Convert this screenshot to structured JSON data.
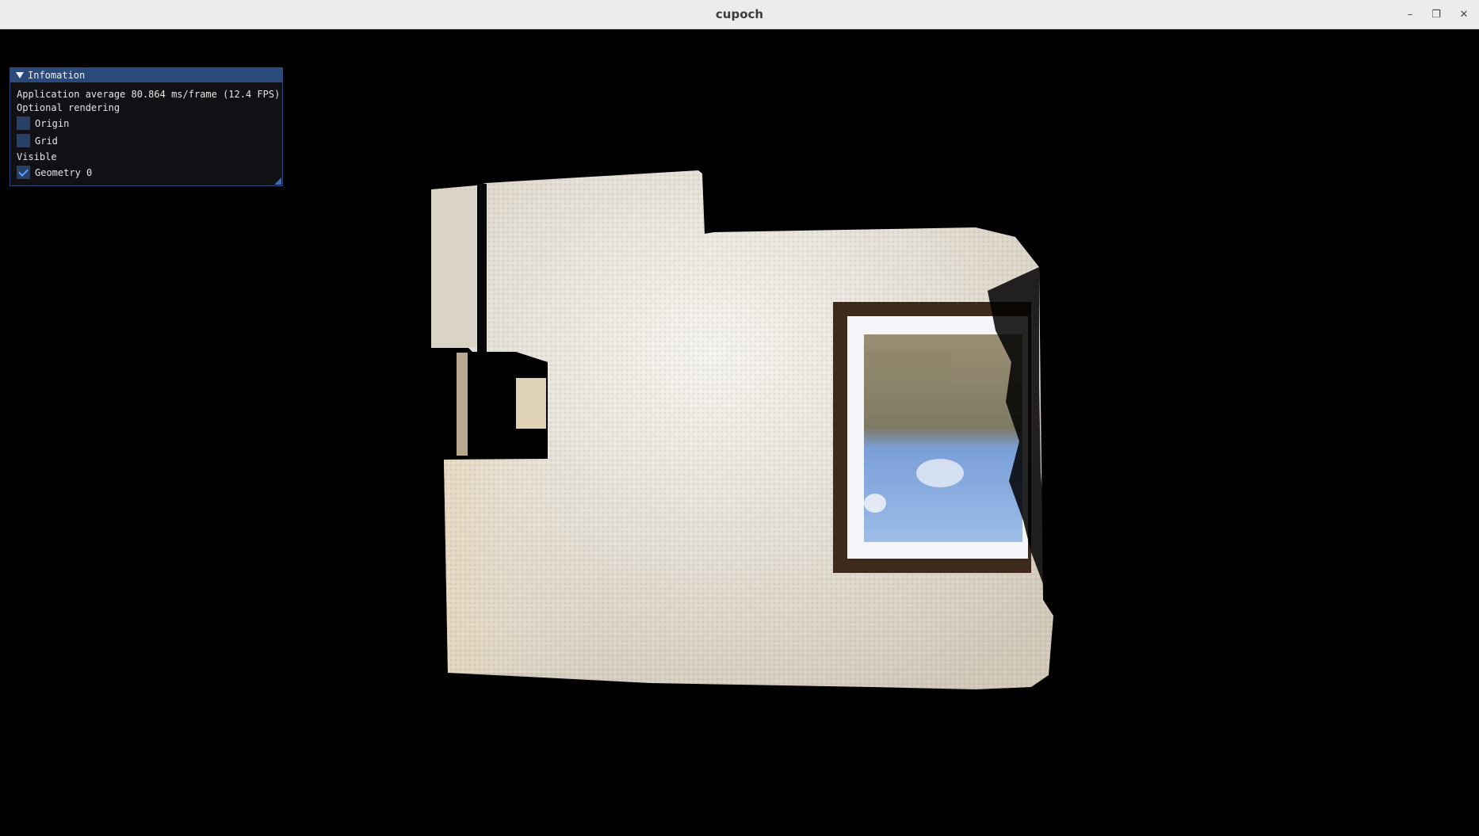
{
  "window": {
    "title": "cupoch",
    "controls": [
      {
        "name": "minimize-button",
        "icon": "minimize-icon",
        "glyph": "–"
      },
      {
        "name": "maximize-button",
        "icon": "restore-icon",
        "glyph": "❐"
      },
      {
        "name": "close-button",
        "icon": "close-icon",
        "glyph": "✕"
      }
    ]
  },
  "panel": {
    "title": "Infomation",
    "stats": "Application average 80.864 ms/frame (12.4 FPS)",
    "optional_heading": "Optional rendering",
    "origin": {
      "label": "Origin",
      "checked": false
    },
    "grid": {
      "label": "Grid",
      "checked": false
    },
    "visible_heading": "Visible",
    "geometry": {
      "label": "Geometry 0",
      "checked": true
    }
  },
  "colors": {
    "viewport_bg": "#000000",
    "panel_header": "#2b4a7c",
    "checkbox_bg": "#294066",
    "checkmark": "#5aa0ff",
    "wall": "#e8e4dc",
    "window_frame": "#4a3322",
    "sky": "#8fb3e6"
  }
}
